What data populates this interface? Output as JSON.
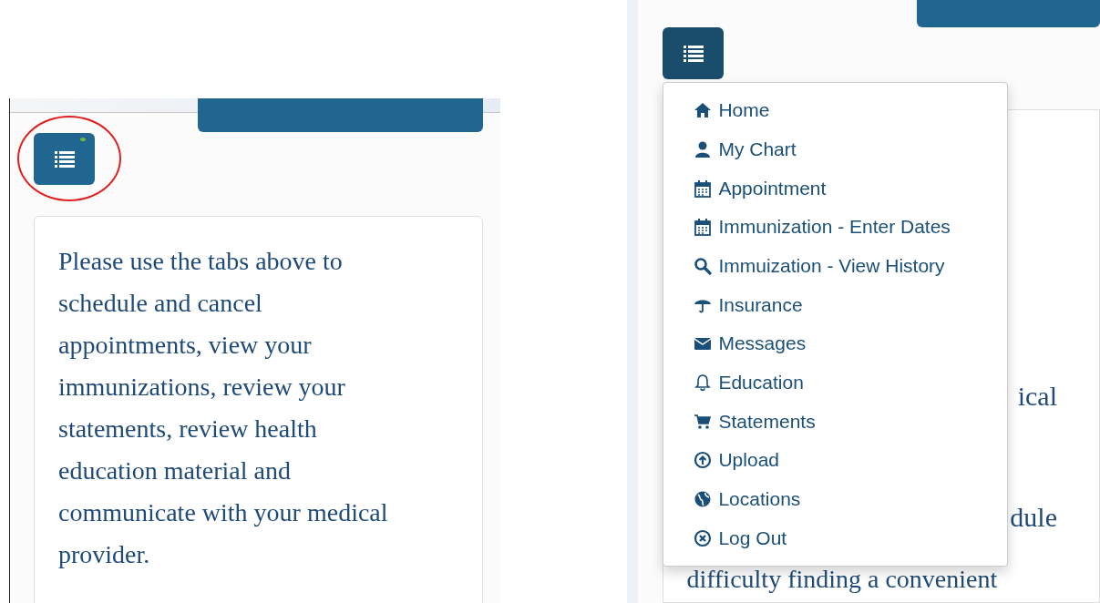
{
  "left_screen": {
    "intro_text": "Please use the tabs above to schedule and cancel appointments, view your immunizations, review your statements, review health education material and communicate with your medical provider."
  },
  "right_screen": {
    "menu_open": true,
    "menu_items": [
      {
        "label": "Home"
      },
      {
        "label": "My Chart"
      },
      {
        "label": "Appointment"
      },
      {
        "label": "Immunization - Enter Dates"
      },
      {
        "label": "Immuization - View History"
      },
      {
        "label": "Insurance"
      },
      {
        "label": "Messages"
      },
      {
        "label": "Education"
      },
      {
        "label": "Statements"
      },
      {
        "label": "Upload"
      },
      {
        "label": "Locations"
      },
      {
        "label": "Log Out"
      }
    ],
    "background_lines": [
      "ical",
      "dule",
      "difficulty finding a convenient"
    ]
  }
}
